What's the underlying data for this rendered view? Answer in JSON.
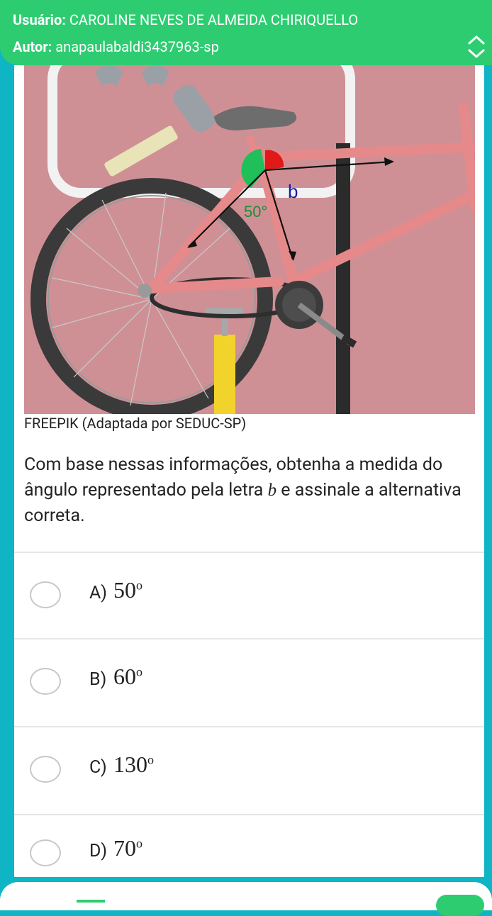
{
  "header": {
    "user_label": "Usuário:",
    "user_name": "CAROLINE NEVES DE ALMEIDA CHIRIQUELLO",
    "author_label": "Autor:",
    "author_name": "anapaulabaldi3437963-sp"
  },
  "figure": {
    "angle_label": "50°",
    "unknown_label": "b",
    "caption": "FREEPIK (Adaptada por SEDUC-SP)"
  },
  "question": {
    "text_before": "Com base nessas informações, obtenha a medida do ângulo representado pela letra ",
    "variable": "b",
    "text_after": " e assinale a alternativa correta."
  },
  "options": [
    {
      "letter": "A)",
      "value": "50",
      "unit": "o"
    },
    {
      "letter": "B)",
      "value": "60",
      "unit": "o"
    },
    {
      "letter": "C)",
      "value": "130",
      "unit": "o"
    },
    {
      "letter": "D)",
      "value": "70",
      "unit": "o"
    }
  ],
  "icons": {
    "toggle": "chevron-up-down-icon"
  }
}
